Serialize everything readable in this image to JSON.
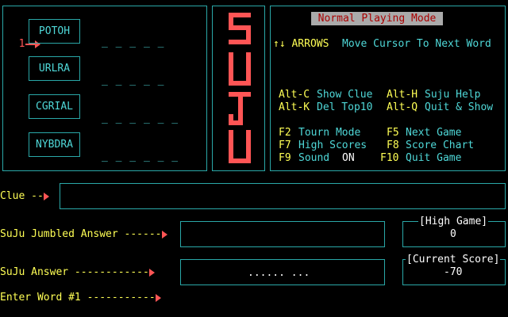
{
  "words": {
    "pointer_num": "1",
    "items": [
      {
        "jumble": "POTOH",
        "blanks": "_ _ _ _ _"
      },
      {
        "jumble": "URLRA",
        "blanks": "_ _ _ _ _"
      },
      {
        "jumble": "CGRIAL",
        "blanks": "_ _ _ _ _ _"
      },
      {
        "jumble": "NYBDRA",
        "blanks": "_ _ _ _ _ _"
      }
    ]
  },
  "logo": {
    "letters": [
      "S",
      "U",
      "J",
      "U"
    ]
  },
  "help": {
    "mode_title": "Normal Playing Mode",
    "arrows_key": "↑↓ ARROWS",
    "arrows_desc": "Move Cursor To Next Word",
    "shortcuts": [
      {
        "key": "Alt-C",
        "desc": "Show Clue"
      },
      {
        "key": "Alt-H",
        "desc": "Suju Help"
      },
      {
        "key": "Alt-K",
        "desc": "Del Top10"
      },
      {
        "key": "Alt-Q",
        "desc": "Quit & Show"
      },
      {
        "key": "F2",
        "desc": "Tourn Mode"
      },
      {
        "key": "F5",
        "desc": "Next Game"
      },
      {
        "key": "F7",
        "desc": "High Scores"
      },
      {
        "key": "F8",
        "desc": "Score Chart"
      },
      {
        "key": "F9",
        "desc": "Sound"
      },
      {
        "key": "F10",
        "desc": "Quit Game"
      }
    ],
    "sound_state": "ON"
  },
  "bottom": {
    "clue_label": "Clue --",
    "clue_value": "",
    "jumbled_label": "SuJu Jumbled Answer ------",
    "jumbled_value": "",
    "answer_label": "SuJu Answer ------------",
    "answer_value": "...... ...",
    "enter_label": "Enter Word #1 -----------",
    "high_game_title": "[High Game]",
    "high_game_value": "0",
    "current_score_title": "[Current Score]",
    "current_score_value": "-70"
  },
  "colors": {
    "cyan": "#4fd8d8",
    "yellow": "#ffff55",
    "red": "#ff5555",
    "border": "#2aa8a8"
  }
}
